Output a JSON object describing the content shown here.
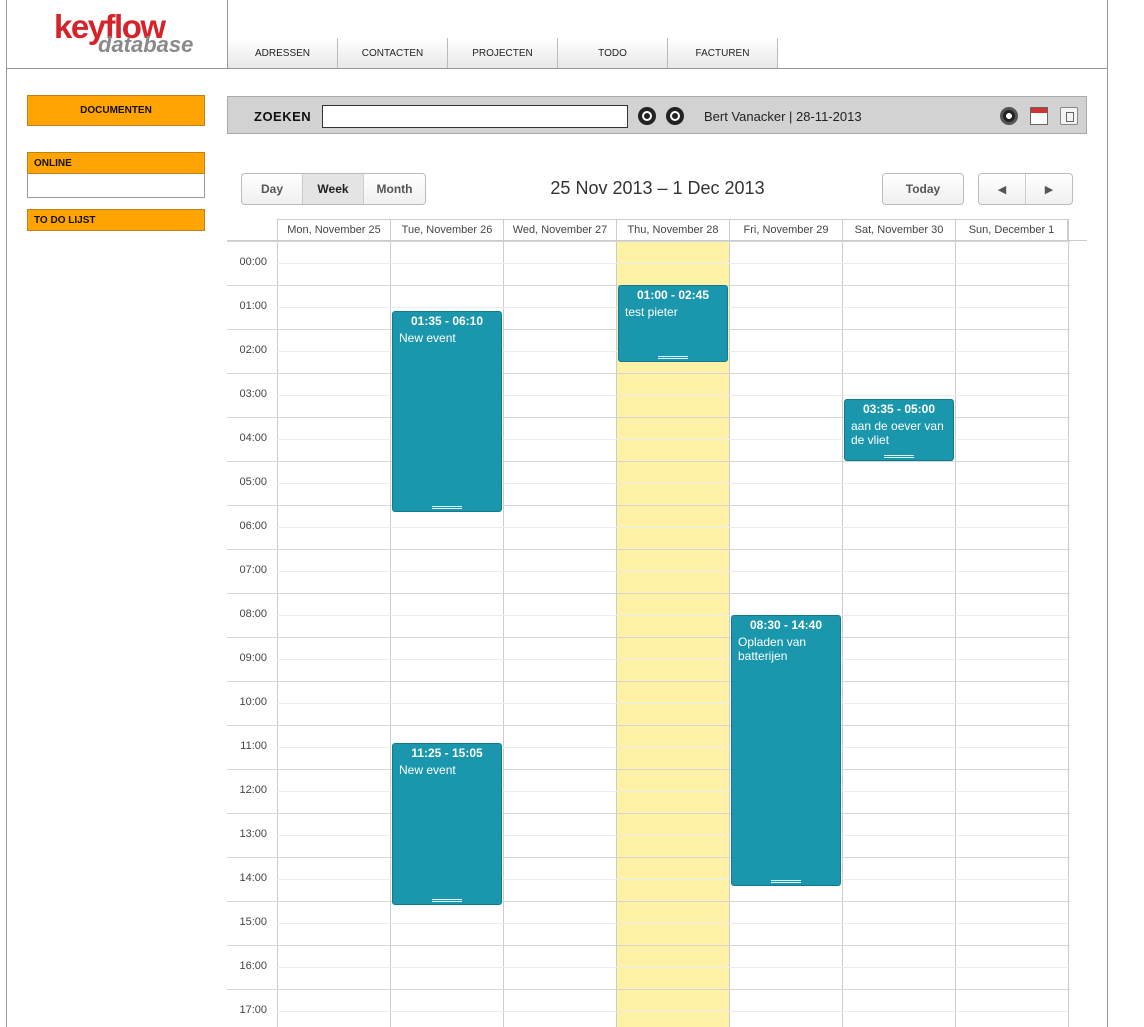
{
  "logo": {
    "top": "keyflow",
    "bottom": "database"
  },
  "nav": [
    "ADRESSEN",
    "CONTACTEN",
    "PROJECTEN",
    "TODO",
    "FACTUREN"
  ],
  "sidebar": {
    "documents": "DOCUMENTEN",
    "online": "ONLINE",
    "todo": "TO DO LIJST"
  },
  "search": {
    "label": "ZOEKEN",
    "value": "",
    "user": "Bert Vanacker | 28-11-2013"
  },
  "calendar": {
    "views": [
      "Day",
      "Week",
      "Month"
    ],
    "active_view": "Week",
    "title": "25 Nov 2013 – 1 Dec 2013",
    "today_label": "Today",
    "prev_glyph": "◀",
    "next_glyph": "▶",
    "days": [
      "Mon, November 25",
      "Tue, November 26",
      "Wed, November 27",
      "Thu, November 28",
      "Fri, November 29",
      "Sat, November 30",
      "Sun, December 1"
    ],
    "hours": [
      "00:00",
      "01:00",
      "02:00",
      "03:00",
      "04:00",
      "05:00",
      "06:00",
      "07:00",
      "08:00",
      "09:00",
      "10:00",
      "11:00",
      "12:00",
      "13:00",
      "14:00",
      "15:00",
      "16:00",
      "17:00"
    ],
    "events": [
      {
        "day": 1,
        "start": 1.583,
        "end": 6.167,
        "time": "01:35 - 06:10",
        "title": "New event"
      },
      {
        "day": 3,
        "start": 1.0,
        "end": 2.75,
        "time": "01:00 - 02:45",
        "title": "test pieter"
      },
      {
        "day": 5,
        "start": 3.583,
        "end": 5.0,
        "time": "03:35 - 05:00",
        "title": "aan de oever van de vliet"
      },
      {
        "day": 4,
        "start": 8.5,
        "end": 14.667,
        "time": "08:30 - 14:40",
        "title": "Opladen van batterijen"
      },
      {
        "day": 1,
        "start": 11.417,
        "end": 15.083,
        "time": "11:25 - 15:05",
        "title": "New event"
      }
    ]
  }
}
